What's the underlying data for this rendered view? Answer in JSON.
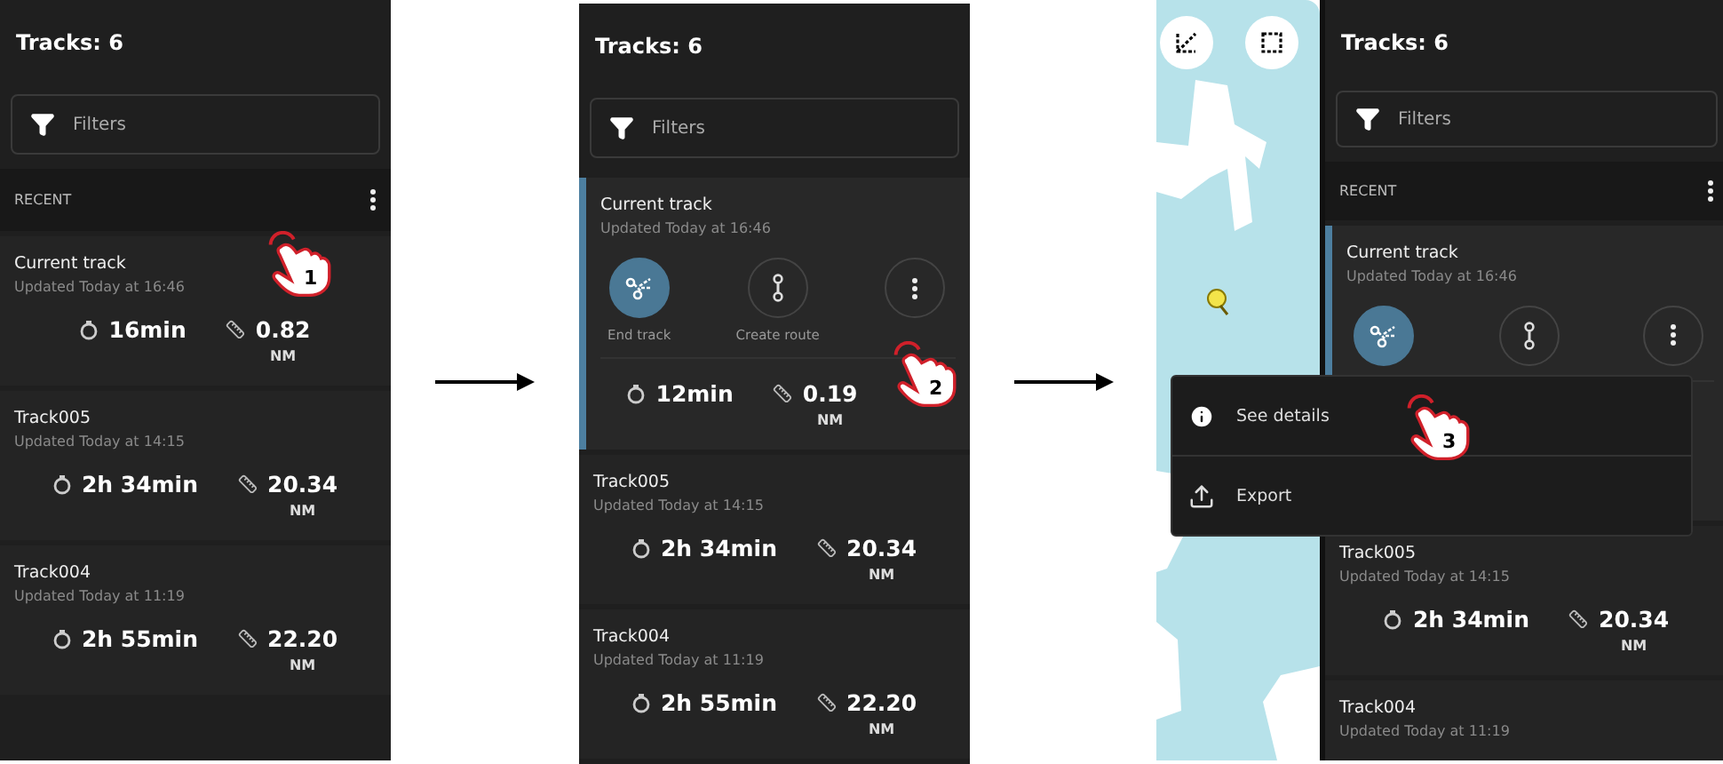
{
  "screens": [
    {
      "title": "Tracks: 6",
      "filter": {
        "placeholder": "Filters"
      },
      "section": "RECENT",
      "tap": {
        "step": "1"
      },
      "tracks": [
        {
          "name": "Current track",
          "updated": "Updated Today at 16:46",
          "selected": false,
          "duration": "16min",
          "distance": "0.82",
          "unit": "NM"
        },
        {
          "name": "Track005",
          "updated": "Updated Today at 14:15",
          "selected": false,
          "duration": "2h 34min",
          "distance": "20.34",
          "unit": "NM"
        },
        {
          "name": "Track004",
          "updated": "Updated Today at 11:19",
          "selected": false,
          "duration": "2h 55min",
          "distance": "22.20",
          "unit": "NM"
        }
      ]
    },
    {
      "title": "Tracks: 6",
      "filter": {
        "placeholder": "Filters"
      },
      "tap": {
        "step": "2"
      },
      "tracks": [
        {
          "name": "Current track",
          "updated": "Updated Today at 16:46",
          "selected": true,
          "expanded": true,
          "actions": [
            {
              "kind": "end",
              "label": "End track"
            },
            {
              "kind": "route",
              "label": "Create route"
            },
            {
              "kind": "more"
            }
          ],
          "duration": "12min",
          "distance": "0.19",
          "unit": "NM"
        },
        {
          "name": "Track005",
          "updated": "Updated Today at 14:15",
          "selected": false,
          "duration": "2h 34min",
          "distance": "20.34",
          "unit": "NM"
        },
        {
          "name": "Track004",
          "updated": "Updated Today at 11:19",
          "selected": false,
          "duration": "2h 55min",
          "distance": "22.20",
          "unit": "NM"
        }
      ]
    },
    {
      "title": "Tracks: 6",
      "filter": {
        "placeholder": "Filters"
      },
      "section": "RECENT",
      "map": true,
      "tap": {
        "step": "3"
      },
      "menu": [
        {
          "kind": "info",
          "label": "See details"
        },
        {
          "kind": "export",
          "label": "Export"
        }
      ],
      "tracks": [
        {
          "name": "Current track",
          "updated": "Updated Today at 16:46",
          "selected": true,
          "expanded": true,
          "actions": [
            {
              "kind": "end"
            },
            {
              "kind": "route"
            },
            {
              "kind": "more"
            }
          ]
        },
        {
          "name": "Track005",
          "updated": "Updated Today at 14:15",
          "selected": false,
          "duration": "2h 34min",
          "distance": "20.34",
          "unit": "NM"
        },
        {
          "name": "Track004",
          "updated": "Updated Today at 11:19",
          "selected": false
        }
      ]
    }
  ]
}
